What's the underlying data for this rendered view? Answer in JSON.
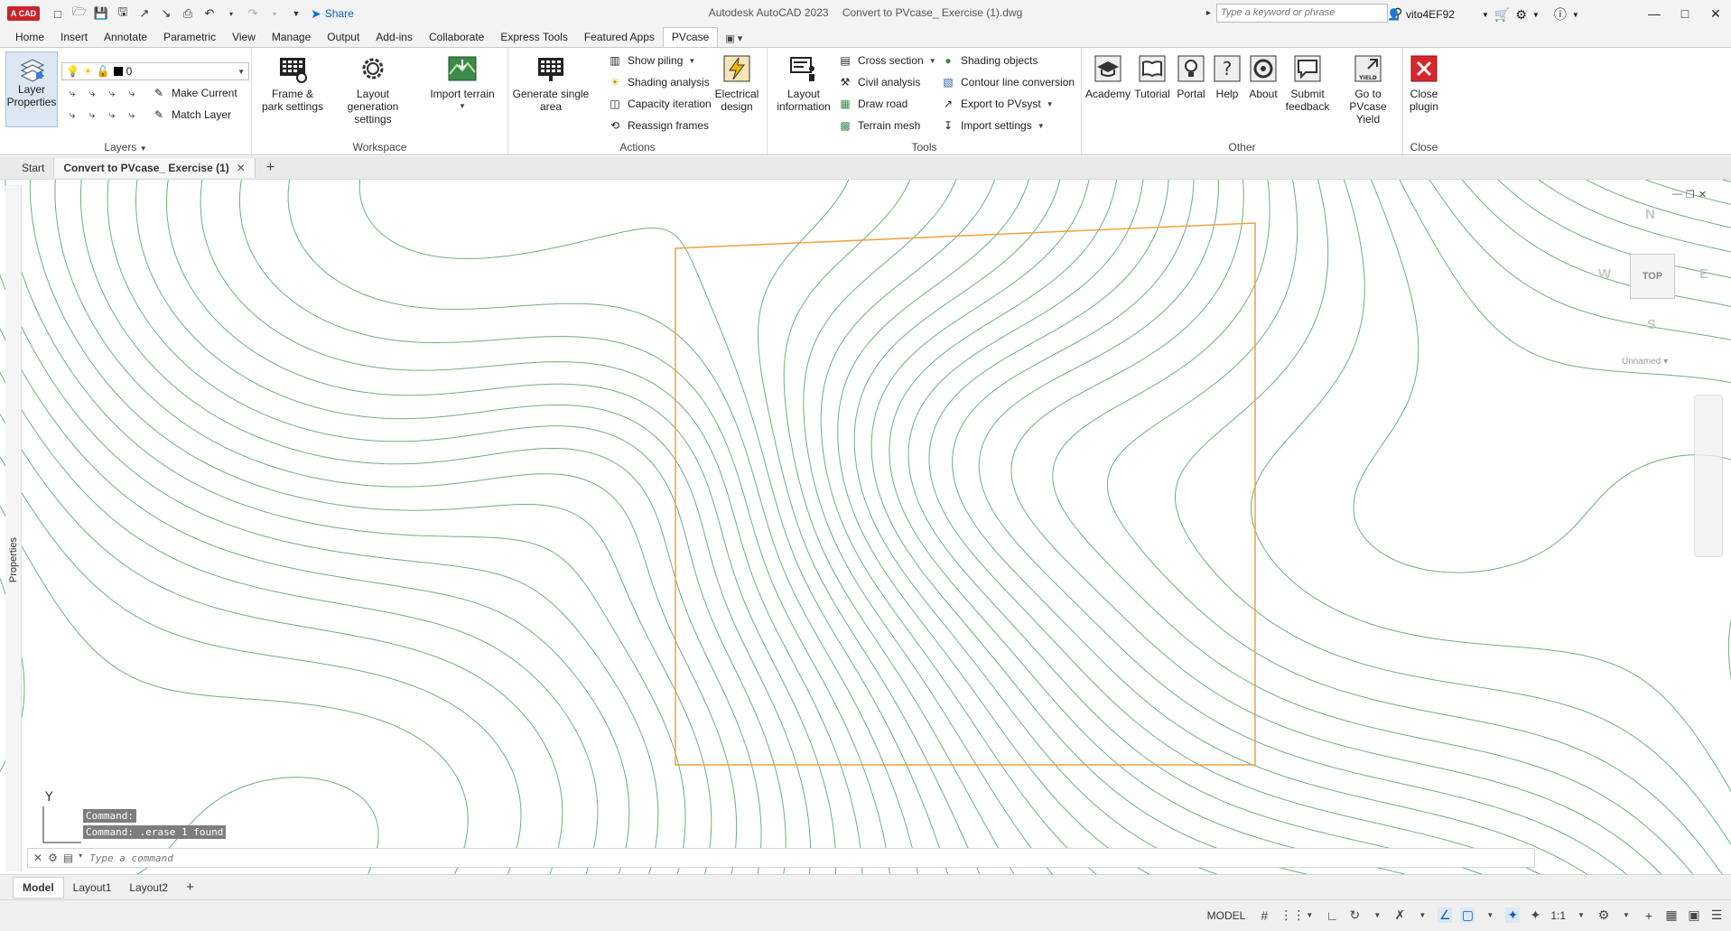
{
  "app": {
    "logo_text": "A CAD",
    "title": "Autodesk AutoCAD 2023",
    "document_name": "Convert to PVcase_ Exercise (1).dwg",
    "share_label": "Share",
    "search_placeholder": "Type a keyword or phrase",
    "username": "vito4EF92"
  },
  "ribbon_tabs": [
    "Home",
    "Insert",
    "Annotate",
    "Parametric",
    "View",
    "Manage",
    "Output",
    "Add-ins",
    "Collaborate",
    "Express Tools",
    "Featured Apps",
    "PVcase"
  ],
  "active_tab": "PVcase",
  "panels": {
    "layers": {
      "title": "Layers",
      "layer_properties": "Layer Properties",
      "current_layer": "0",
      "make_current": "Make Current",
      "match_layer": "Match Layer"
    },
    "workspace": {
      "title": "Workspace",
      "frame_park": "Frame & park settings",
      "layout_generation": "Layout generation settings",
      "import_terrain": "Import terrain"
    },
    "actions": {
      "title": "Actions",
      "generate_single_area": "Generate single area",
      "show_piling": "Show piling",
      "shading_analysis": "Shading analysis",
      "capacity_iteration": "Capacity iteration",
      "reassign_frames": "Reassign frames",
      "electrical_design": "Electrical design"
    },
    "tools": {
      "title": "Tools",
      "layout_information": "Layout information",
      "cross_section": "Cross section",
      "civil_analysis": "Civil analysis",
      "draw_road": "Draw road",
      "terrain_mesh": "Terrain mesh",
      "shading_objects": "Shading objects",
      "contour_line_conversion": "Contour line conversion",
      "export_pvsyst": "Export to PVsyst",
      "import_settings": "Import settings"
    },
    "other": {
      "title": "Other",
      "academy": "Academy",
      "tutorial": "Tutorial",
      "portal": "Portal",
      "help": "Help",
      "about": "About",
      "submit_feedback": "Submit feedback",
      "go_to_yield": "Go to PVcase Yield",
      "yield_badge": "YIELD"
    },
    "close": {
      "title": "Close",
      "close_plugin": "Close plugin"
    }
  },
  "doc_tabs": {
    "start": "Start",
    "active": "Convert to PVcase_ Exercise (1)"
  },
  "drawing": {
    "properties_label": "Properties",
    "viewcube": {
      "top": "TOP",
      "n": "N",
      "s": "S",
      "e": "E",
      "w": "W"
    },
    "ucs_name": "Unnamed",
    "ucs_y": "Y",
    "contour_color": "#6cb07a",
    "boundary_color": "#f0a040"
  },
  "command": {
    "history": [
      "Command:",
      "Command:  .erase 1 found"
    ],
    "placeholder": "Type a command"
  },
  "layout_tabs": [
    "Model",
    "Layout1",
    "Layout2"
  ],
  "status": {
    "model": "MODEL",
    "scale": "1:1"
  }
}
